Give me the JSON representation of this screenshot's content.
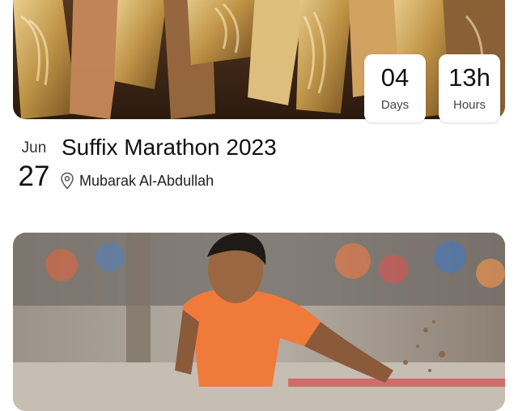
{
  "events": [
    {
      "countdown": [
        {
          "value": "04",
          "unit": "Days"
        },
        {
          "value": "13h",
          "unit": "Hours"
        }
      ],
      "date": {
        "month": "Jun",
        "day": "27"
      },
      "title": "Suffix Marathon 2023",
      "location": {
        "icon": "location-pin-icon",
        "text": "Mubarak Al-Abdullah"
      },
      "image": {
        "description_colors": [
          "#b5894a",
          "#e0c07a",
          "#7a4f2a"
        ]
      }
    },
    {
      "image": {
        "description_colors": [
          "#f07a3a",
          "#8a7f72",
          "#c9c3bb"
        ]
      }
    }
  ]
}
